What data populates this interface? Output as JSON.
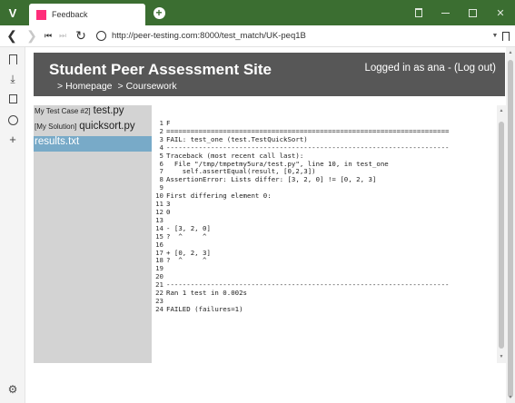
{
  "browser": {
    "menu_label": "V",
    "tab_title": "Feedback",
    "tab_favicon_color": "#ff2d7a",
    "new_tab_label": "+",
    "window_controls": [
      "trash-icon",
      "minimize-icon",
      "maximize-icon",
      "close-icon"
    ],
    "url": "http://peer-testing.com:8000/test_match/UK-peq1B",
    "side_panel_icons": [
      "bookmarks-icon",
      "downloads-icon",
      "notes-icon",
      "history-icon",
      "add-panel-icon",
      "settings-icon"
    ],
    "theme_color": "#3b6e31"
  },
  "site": {
    "title": "Student Peer Assessment Site",
    "breadcrumb": [
      "Homepage",
      "Coursework"
    ],
    "login_text": "Logged in as ana - ",
    "logout_label": "(Log out)",
    "header_color": "#575757"
  },
  "files": [
    {
      "role": "My Test Case #2]",
      "name": "test.py",
      "selected": false
    },
    {
      "role": "[My Solution]",
      "name": "quicksort.py",
      "selected": false
    },
    {
      "role": "",
      "name": "results.txt",
      "selected": true
    }
  ],
  "output": {
    "lines": [
      {
        "n": "1",
        "text": "F"
      },
      {
        "n": "2",
        "text": "======================================================================"
      },
      {
        "n": "3",
        "text": "FAIL: test_one (test.TestQuickSort)"
      },
      {
        "n": "4",
        "text": "----------------------------------------------------------------------"
      },
      {
        "n": "5",
        "text": "Traceback (most recent call last):"
      },
      {
        "n": "6",
        "text": "  File \"/tmp/tmpetmy5ura/test.py\", line 10, in test_one"
      },
      {
        "n": "7",
        "text": "    self.assertEqual(result, [0,2,3])"
      },
      {
        "n": "8",
        "text": "AssertionError: Lists differ: [3, 2, 0] != [0, 2, 3]"
      },
      {
        "n": "9",
        "text": ""
      },
      {
        "n": "10",
        "text": "First differing element 0:"
      },
      {
        "n": "11",
        "text": "3"
      },
      {
        "n": "12",
        "text": "0"
      },
      {
        "n": "13",
        "text": ""
      },
      {
        "n": "14",
        "text": "- [3, 2, 0]"
      },
      {
        "n": "15",
        "text": "?  ^     ^"
      },
      {
        "n": "16",
        "text": ""
      },
      {
        "n": "17",
        "text": "+ [0, 2, 3]"
      },
      {
        "n": "18",
        "text": "?  ^     ^"
      },
      {
        "n": "19",
        "text": ""
      },
      {
        "n": "20",
        "text": ""
      },
      {
        "n": "21",
        "text": "----------------------------------------------------------------------"
      },
      {
        "n": "22",
        "text": "Ran 1 test in 0.002s"
      },
      {
        "n": "23",
        "text": ""
      },
      {
        "n": "24",
        "text": "FAILED (failures=1)"
      }
    ]
  }
}
